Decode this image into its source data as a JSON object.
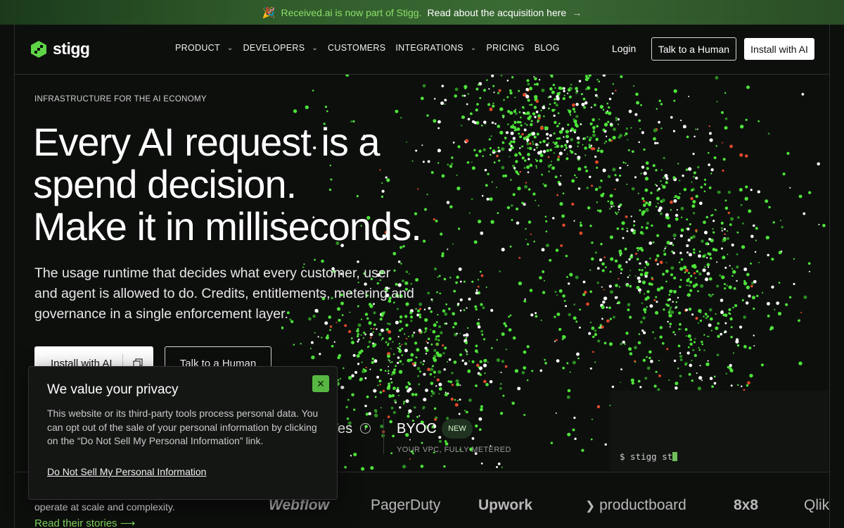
{
  "announcement": {
    "emoji": "🎉",
    "highlight": "Received.ai is now part of Stigg.",
    "link": "Read about the acquisition here",
    "arrow": "→"
  },
  "header": {
    "brand": "stigg",
    "nav": [
      {
        "label": "PRODUCT",
        "dropdown": true
      },
      {
        "label": "DEVELOPERS",
        "dropdown": true
      },
      {
        "label": "CUSTOMERS",
        "dropdown": false
      },
      {
        "label": "INTEGRATIONS",
        "dropdown": true
      },
      {
        "label": "PRICING",
        "dropdown": false
      },
      {
        "label": "BLOG",
        "dropdown": false
      }
    ],
    "login": "Login",
    "talk": "Talk to a Human",
    "install": "Install with AI"
  },
  "hero": {
    "eyebrow": "INFRASTRUCTURE FOR THE AI ECONOMY",
    "headline_1": "Every AI request is a",
    "headline_2": "spend decision.",
    "headline_3": "Make it in milliseconds.",
    "subtitle": "The usage runtime that decides what every customer, user and agent is allowed to do. Credits, entitlements, metering and governance in a single enforcement layer.",
    "install": "Install with AI",
    "talk": "Talk to a Human",
    "feature_partial": "es",
    "byoc": "BYOC",
    "new_badge": "NEW",
    "byoc_sub": "YOUR VPC, FULLY METERED",
    "terminal": "$ stigg st"
  },
  "customers": {
    "tagline": "operate at scale and complexity.",
    "link": "Read their stories",
    "arrow": "⟶",
    "logos": [
      "Webflow",
      "PagerDuty",
      "Upwork",
      "productboard",
      "8x8",
      "Qlik"
    ]
  },
  "privacy": {
    "title": "We value your privacy",
    "body": "This website or its third-party tools process personal data. You can opt out of the sale of your personal information by clicking on the “Do Not Sell My Personal Information” link.",
    "link": "Do Not Sell My Personal Information",
    "close": "✕"
  },
  "colors": {
    "background": "#0d0f0d",
    "accent_green": "#57b742",
    "link_green": "#7fd45c",
    "particle_red": "#e04a2a"
  }
}
